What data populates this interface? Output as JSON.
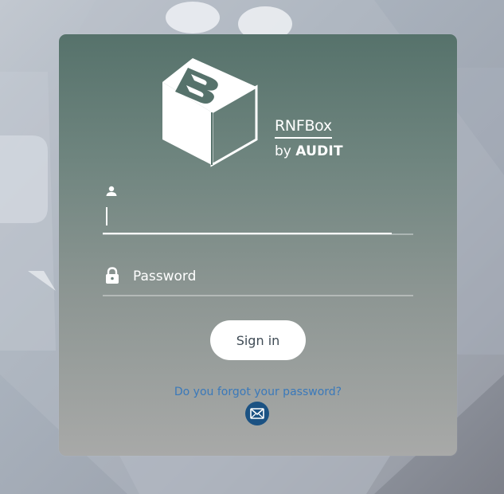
{
  "brand": {
    "name": "RNFBox",
    "by_prefix": "by",
    "by_company": "AUDIT"
  },
  "login": {
    "username_value": "",
    "password_placeholder": "Password",
    "signin_label": "Sign in",
    "forgot_label": "Do you forgot your password?"
  },
  "icons": {
    "logo": "cube-b-logo-icon",
    "user": "user-icon",
    "lock": "lock-icon",
    "mail": "mail-icon"
  },
  "colors": {
    "card_top": "#56726b",
    "card_bottom": "#a8a9a8",
    "button_bg": "#ffffff",
    "button_text": "#3f4b55",
    "link": "#3a79ba",
    "mail_bg": "#1b5283"
  }
}
